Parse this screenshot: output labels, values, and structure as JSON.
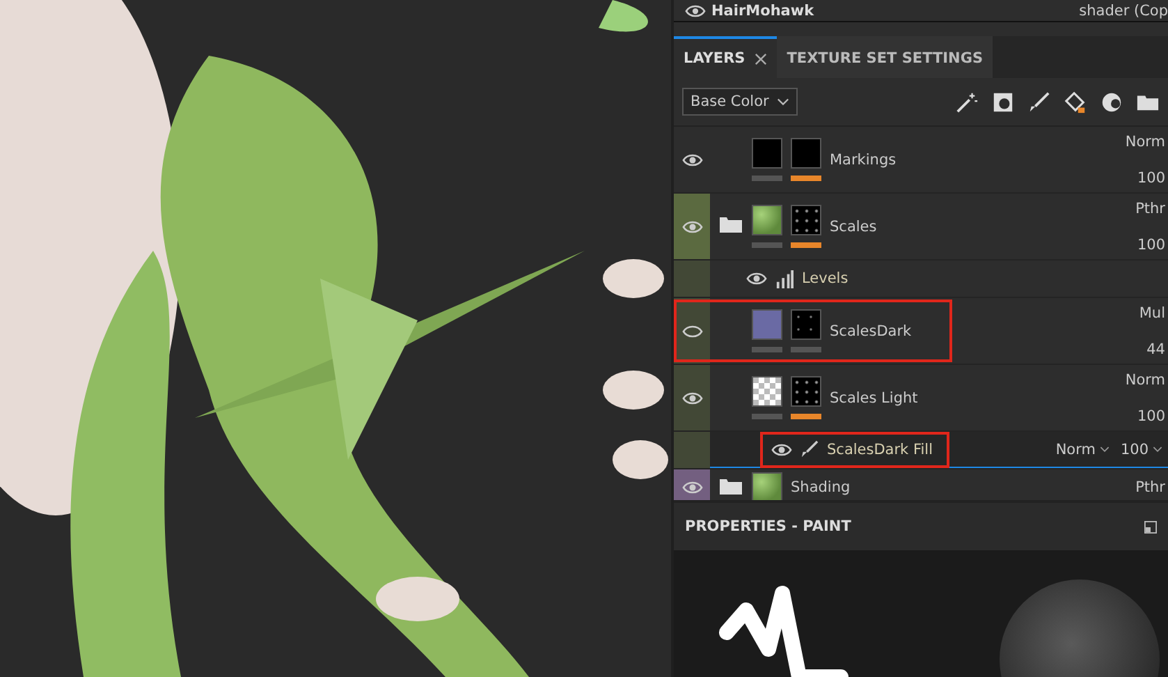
{
  "texture_set": {
    "visible": true,
    "name": "HairMohawk",
    "shader": "shader (Cop"
  },
  "tabs": [
    {
      "label": "LAYERS",
      "selected": true,
      "closable": true
    },
    {
      "label": "TEXTURE SET SETTINGS",
      "selected": false,
      "closable": false
    }
  ],
  "channel_dropdown": {
    "value": "Base Color"
  },
  "layers": [
    {
      "kind": "layer",
      "name": "Markings",
      "visible": true,
      "selected": false,
      "highlighted": false,
      "thumbnails": [
        {
          "kind": "solid",
          "color": "#000000",
          "selected": false
        },
        {
          "kind": "solid",
          "color": "#000000",
          "selected": true
        }
      ],
      "blend": "Norm",
      "opacity": "100"
    },
    {
      "kind": "folder",
      "name": "Scales",
      "visible": true,
      "selected": false,
      "highlighted": false,
      "color": "#5b6a40",
      "thumbnails": [
        {
          "kind": "texture",
          "selected": false
        },
        {
          "kind": "pattern",
          "selected": true
        }
      ],
      "blend": "Pthr",
      "opacity": "100",
      "children": [
        {
          "kind": "levels",
          "name": "Levels",
          "visible": true,
          "selected": false,
          "highlighted": false
        },
        {
          "kind": "layer",
          "name": "ScalesDark",
          "visible": false,
          "selected": false,
          "highlighted": true,
          "thumbnails": [
            {
              "kind": "solid",
              "color": "#6a6aa4",
              "selected": false
            },
            {
              "kind": "dots",
              "selected": false
            }
          ],
          "blend": "Mul",
          "opacity": "44"
        },
        {
          "kind": "layer",
          "name": "Scales Light",
          "visible": true,
          "selected": false,
          "highlighted": false,
          "thumbnails": [
            {
              "kind": "checker",
              "selected": false
            },
            {
              "kind": "pattern",
              "selected": true
            }
          ],
          "blend": "Norm",
          "opacity": "100",
          "children": [
            {
              "kind": "paint",
              "name": "ScalesDark Fill",
              "visible": true,
              "selected": true,
              "highlighted": true,
              "blend": "Norm",
              "opacity": "100"
            }
          ]
        }
      ]
    },
    {
      "kind": "folder",
      "name": "Shading",
      "visible": true,
      "selected": false,
      "highlighted": false,
      "color": "#735f80",
      "thumbnails": [
        {
          "kind": "texture"
        }
      ],
      "blend": "Pthr"
    }
  ],
  "properties": {
    "title": "PROPERTIES - PAINT"
  }
}
